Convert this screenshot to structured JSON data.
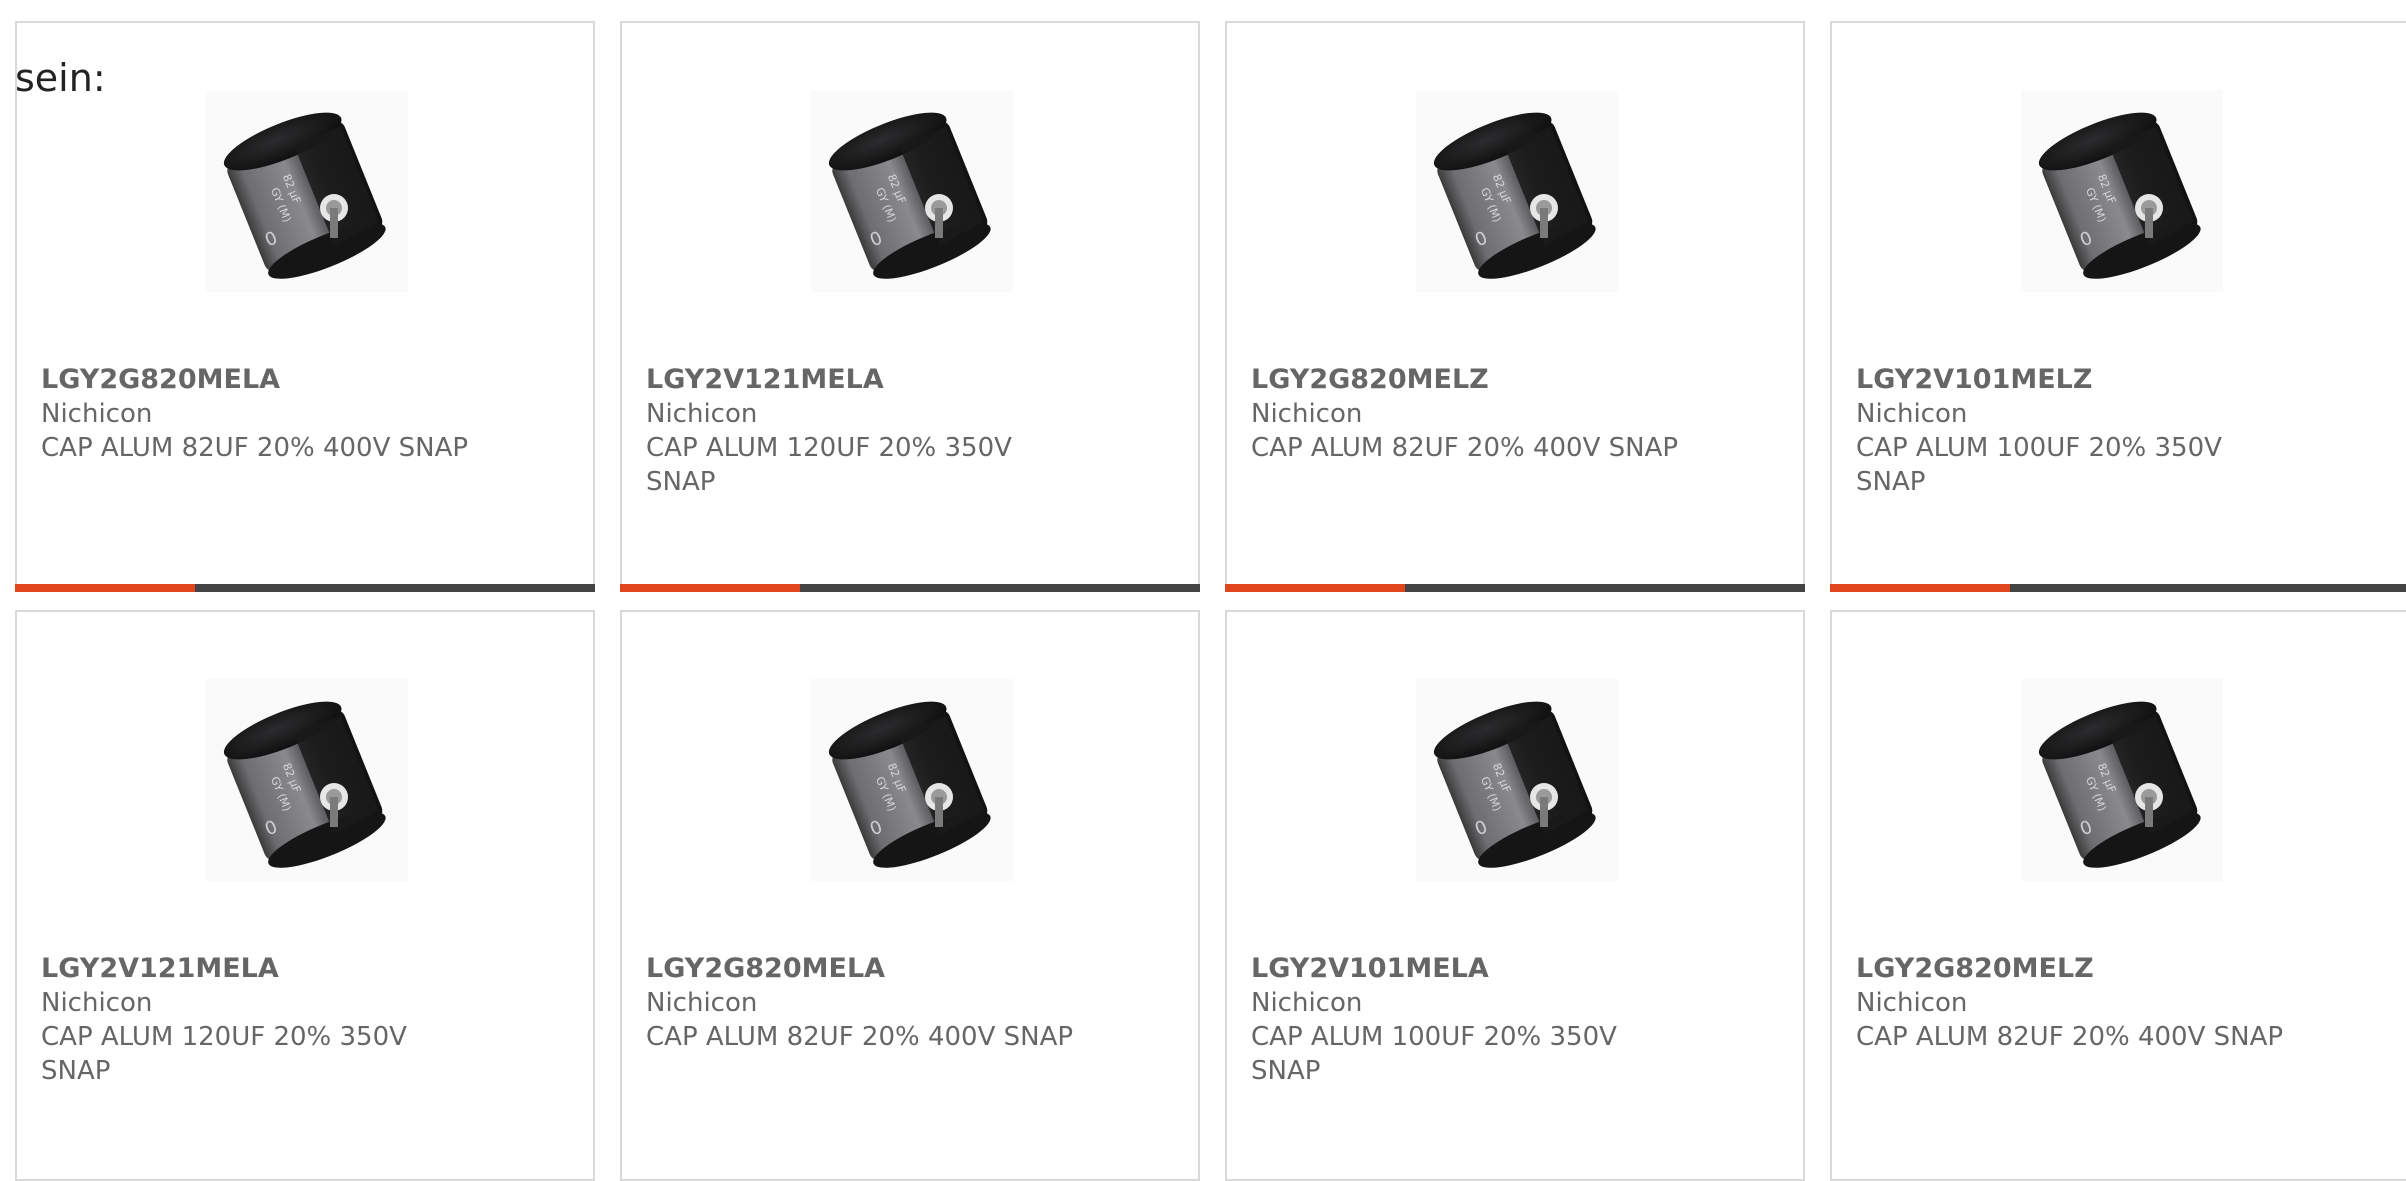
{
  "heading": "sein:",
  "colors": {
    "accent": "#e2461e",
    "bar_track": "#444444",
    "card_border": "#d9d9d9",
    "text": "#666666"
  },
  "products": [
    {
      "part": "LGY2G820MELA",
      "manufacturer": "Nichicon",
      "description": "CAP ALUM 82UF 20% 400V SNAP",
      "image_icon": "capacitor-image",
      "bar_fill": 0.31
    },
    {
      "part": "LGY2V121MELA",
      "manufacturer": "Nichicon",
      "description": "CAP ALUM 120UF 20% 350V SNAP",
      "image_icon": "capacitor-image",
      "bar_fill": 0.31
    },
    {
      "part": "LGY2G820MELZ",
      "manufacturer": "Nichicon",
      "description": "CAP ALUM 82UF 20% 400V SNAP",
      "image_icon": "capacitor-image",
      "bar_fill": 0.31
    },
    {
      "part": "LGY2V101MELZ",
      "manufacturer": "Nichicon",
      "description": "CAP ALUM 100UF 20% 350V SNAP",
      "image_icon": "capacitor-image",
      "bar_fill": 0.31
    },
    {
      "part": "LGY2V121MELA",
      "manufacturer": "Nichicon",
      "description": "CAP ALUM 120UF 20% 350V SNAP",
      "image_icon": "capacitor-image",
      "bar_fill": 0
    },
    {
      "part": "LGY2G820MELA",
      "manufacturer": "Nichicon",
      "description": "CAP ALUM 82UF 20% 400V SNAP",
      "image_icon": "capacitor-image",
      "bar_fill": 0
    },
    {
      "part": "LGY2V101MELA",
      "manufacturer": "Nichicon",
      "description": "CAP ALUM 100UF 20% 350V SNAP",
      "image_icon": "capacitor-image",
      "bar_fill": 0
    },
    {
      "part": "LGY2G820MELZ",
      "manufacturer": "Nichicon",
      "description": "CAP ALUM 82UF 20% 400V SNAP",
      "image_icon": "capacitor-image",
      "bar_fill": 0
    }
  ]
}
